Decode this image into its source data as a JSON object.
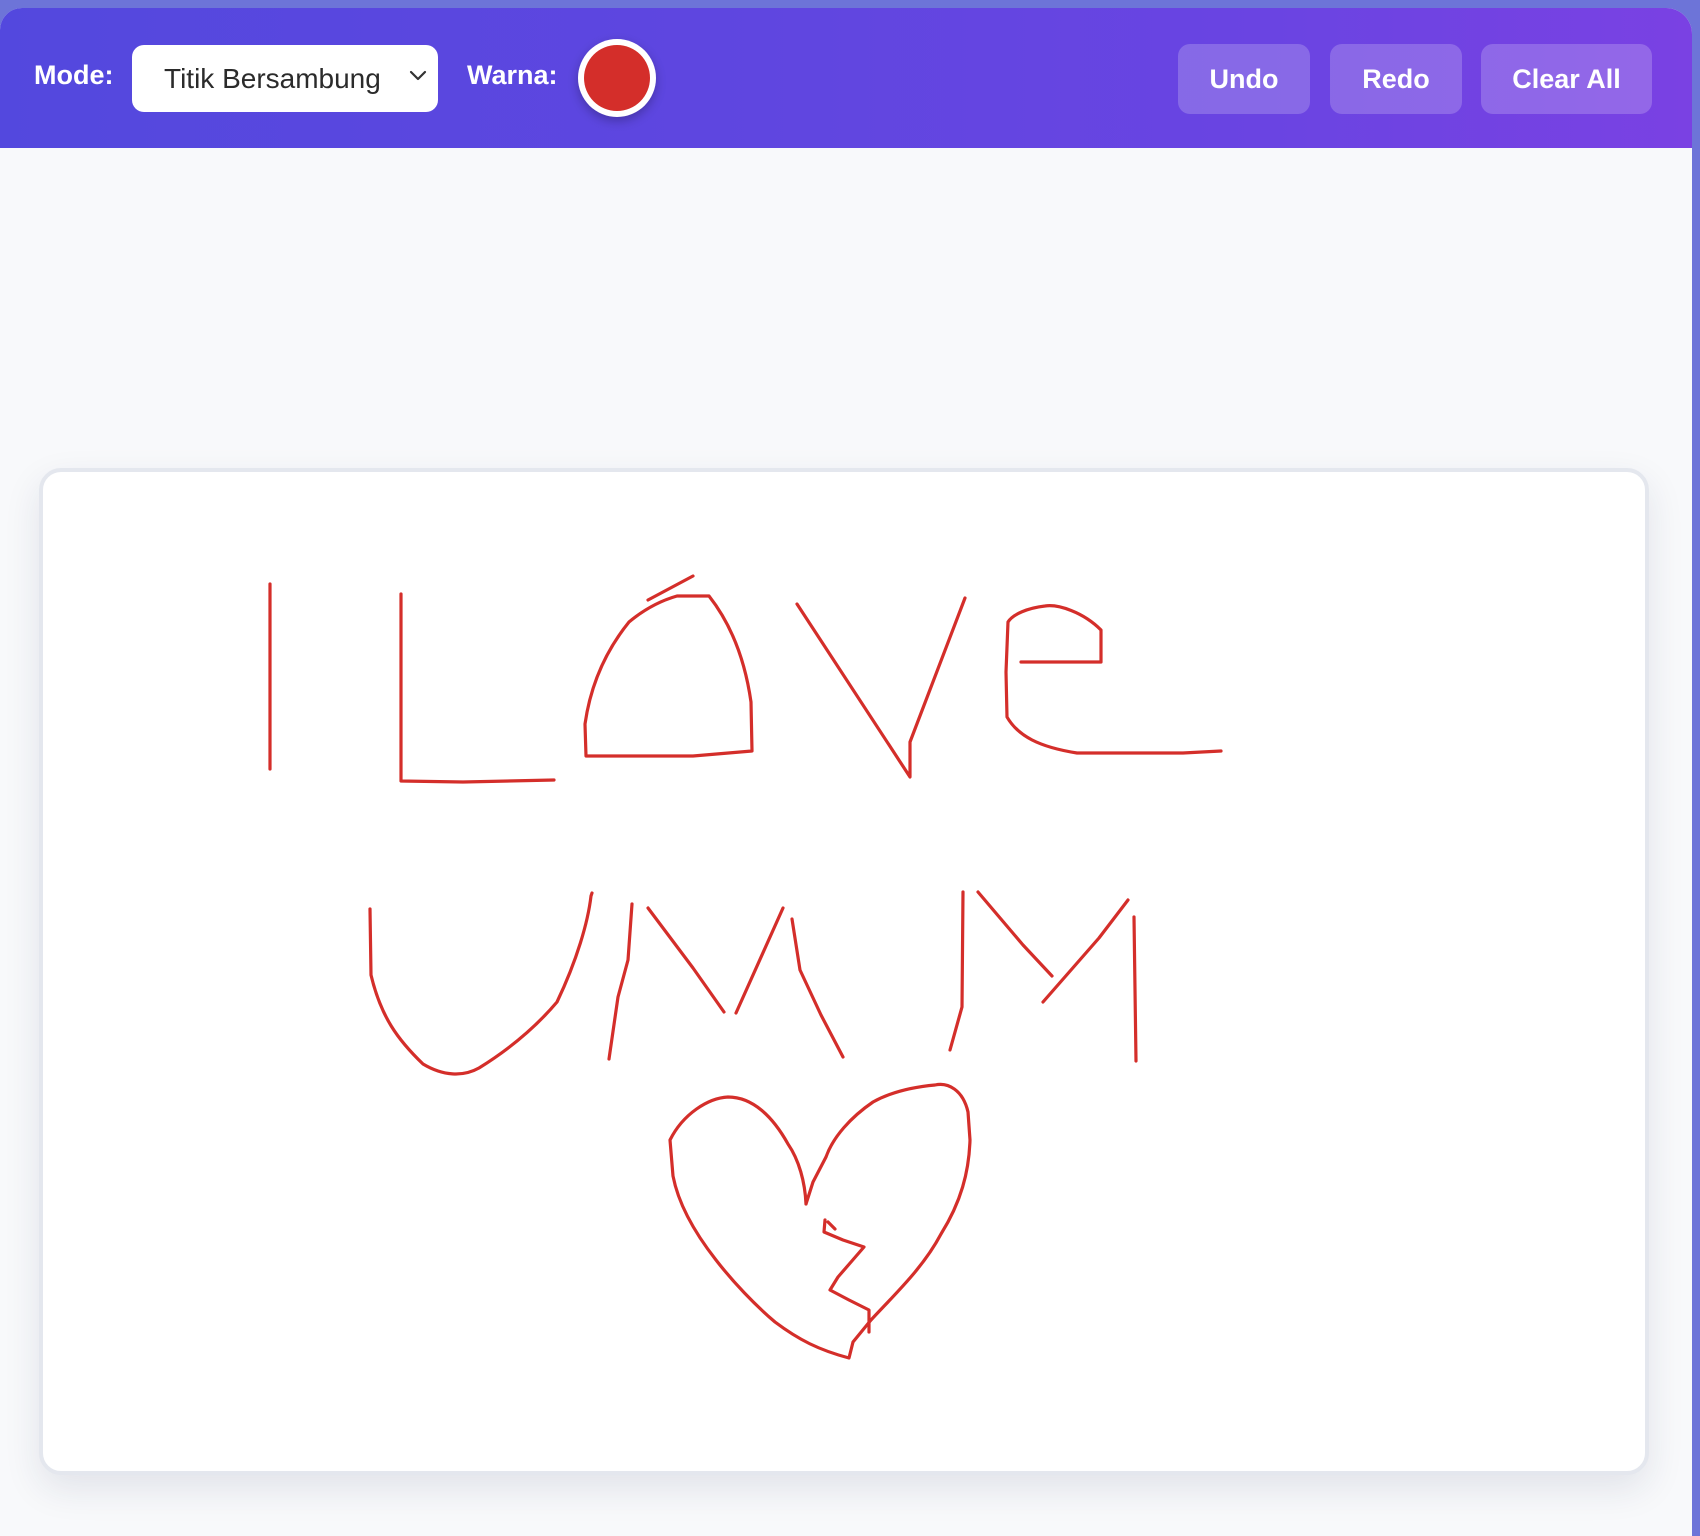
{
  "toolbar": {
    "mode_label": "Mode:",
    "mode_value": "Titik Bersambung",
    "color_label": "Warna:",
    "undo_label": "Undo",
    "redo_label": "Redo",
    "clear_label": "Clear All"
  },
  "colors": {
    "brush": "#d42e2a",
    "toolbar_start": "#5348de",
    "toolbar_end": "#7a41e3"
  },
  "icons": {
    "mode_dropdown": "chevron-down-icon"
  }
}
